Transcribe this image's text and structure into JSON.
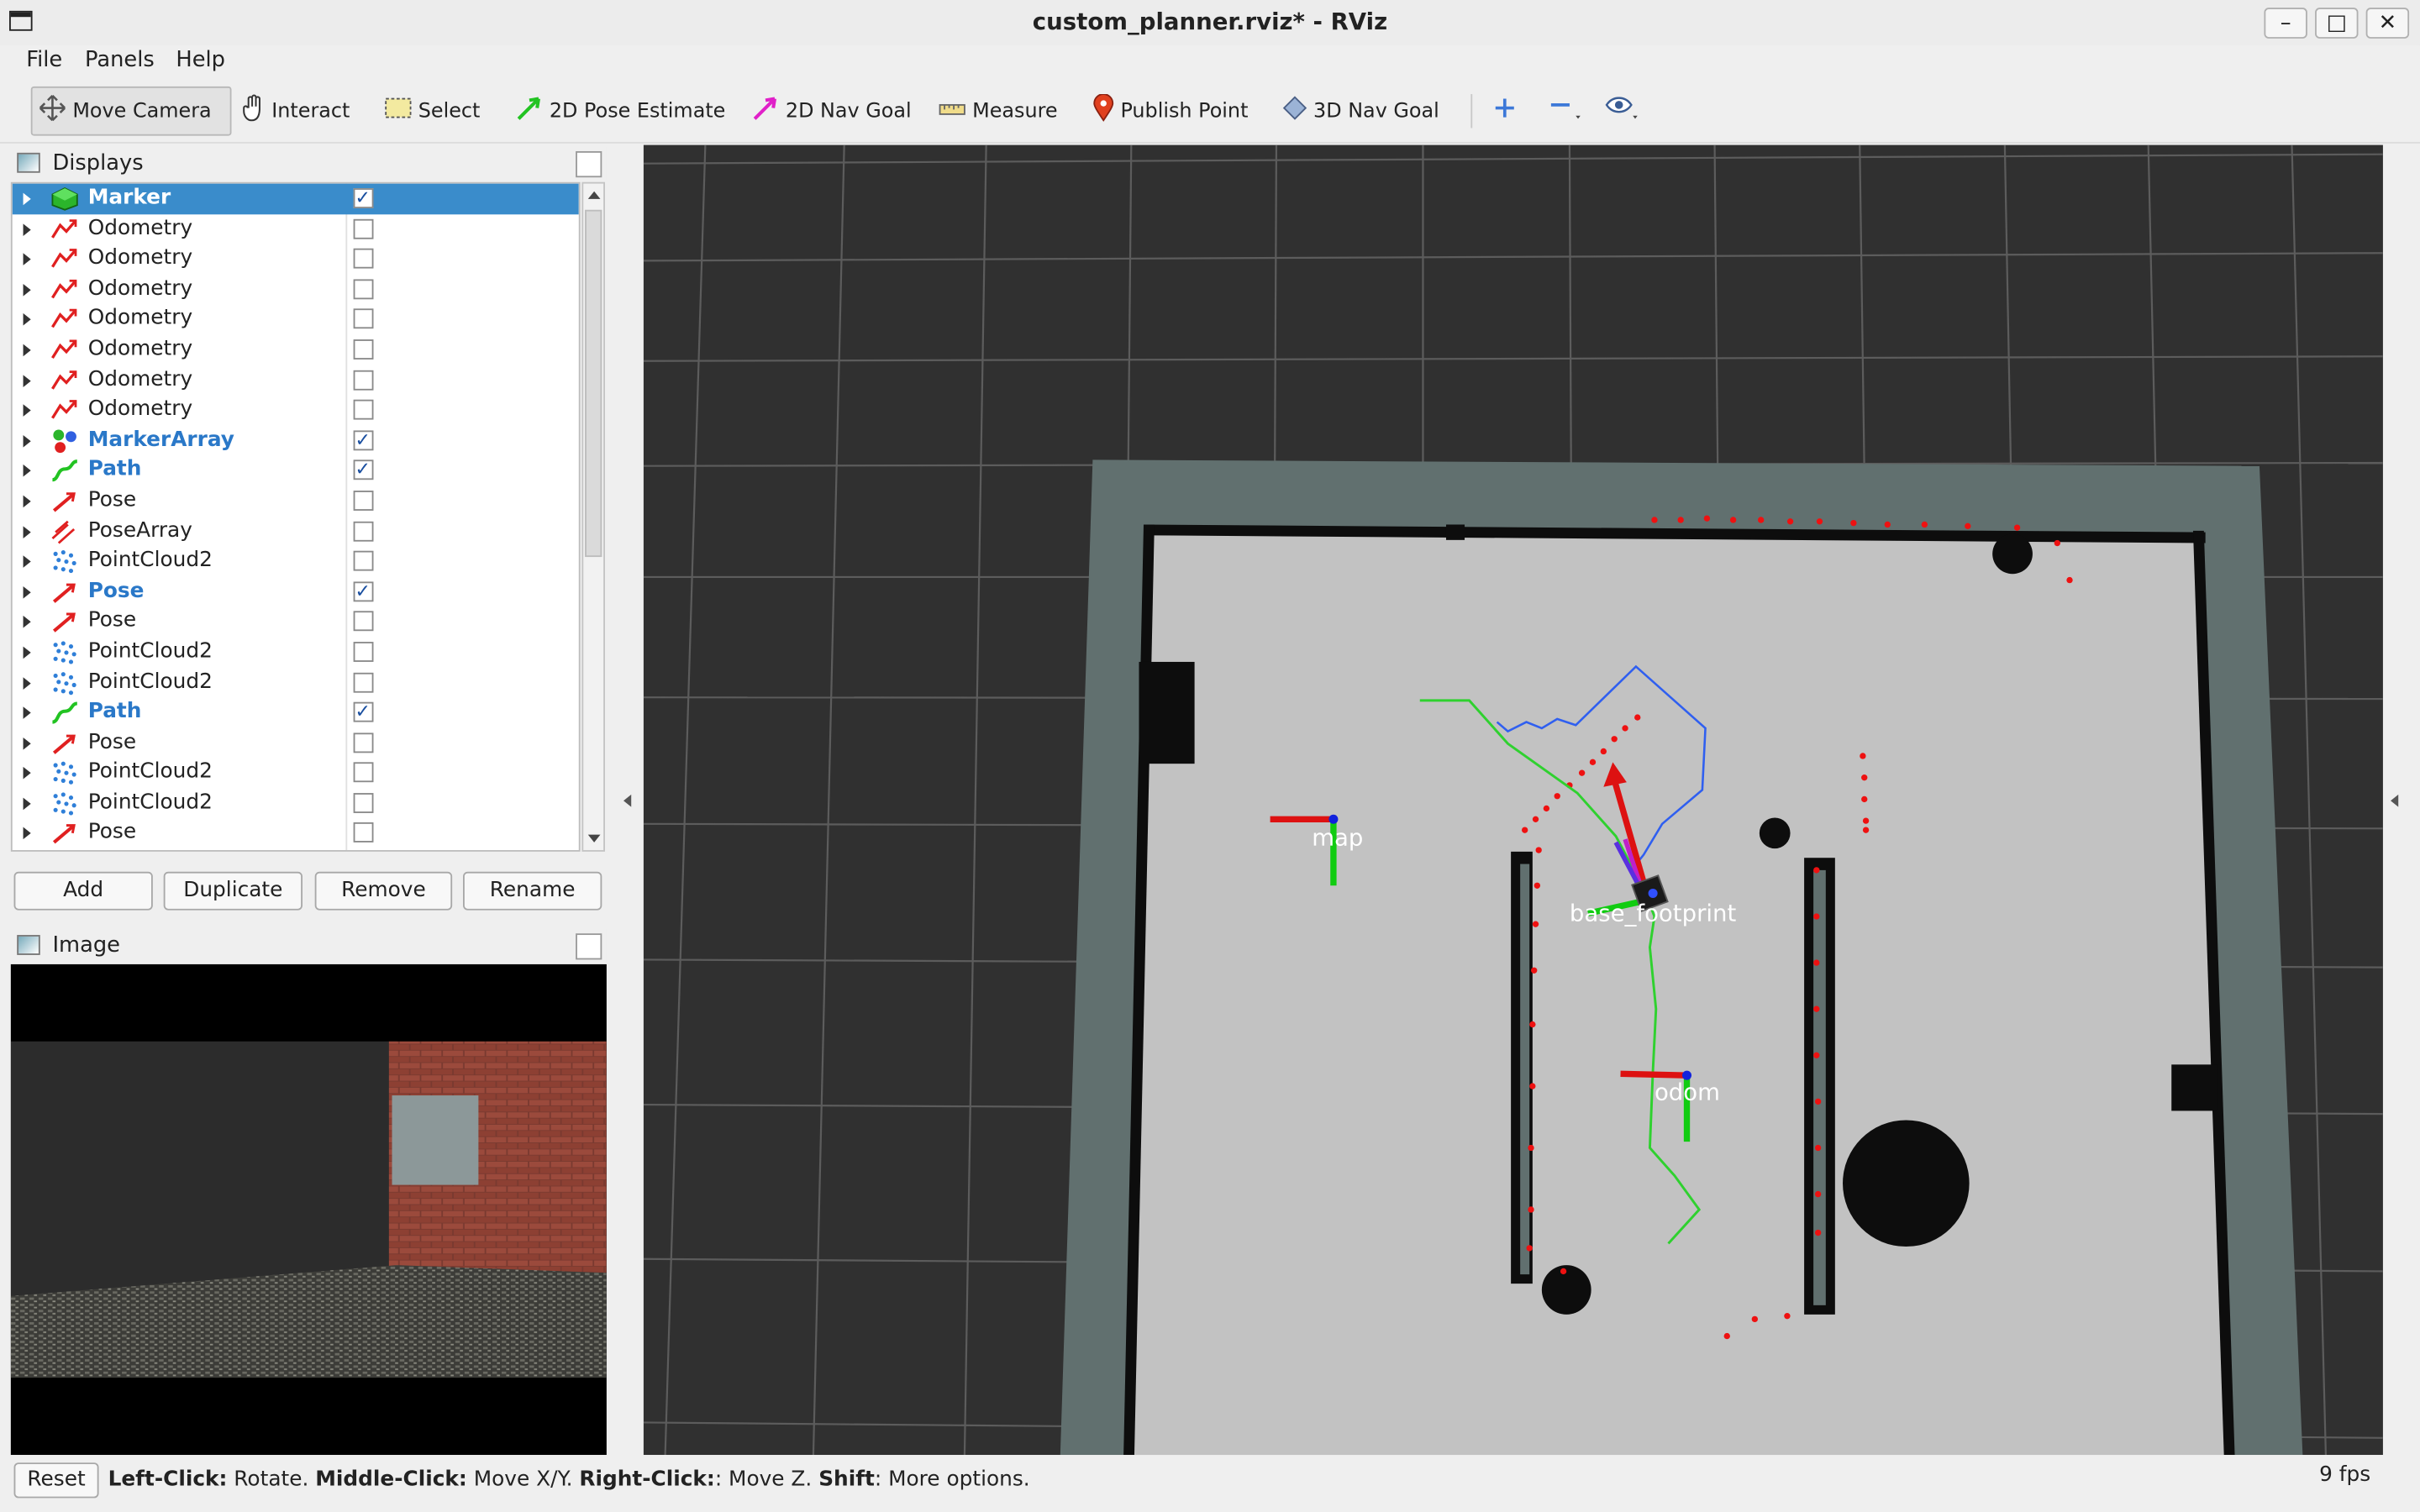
{
  "window": {
    "title": "custom_planner.rviz* - RViz"
  },
  "menu": {
    "file": "File",
    "panels": "Panels",
    "help": "Help"
  },
  "toolbar": {
    "move_camera": "Move Camera",
    "interact": "Interact",
    "select": "Select",
    "pose_estimate": "2D Pose Estimate",
    "nav_goal": "2D Nav Goal",
    "measure": "Measure",
    "publish_point": "Publish Point",
    "nav_goal_3d": "3D Nav Goal"
  },
  "displays_panel": {
    "title": "Displays",
    "items": [
      {
        "name": "Marker",
        "checked": true,
        "bold": true,
        "selected": true,
        "icon": "marker-icon"
      },
      {
        "name": "Odometry",
        "checked": false,
        "bold": false,
        "icon": "odometry-icon"
      },
      {
        "name": "Odometry",
        "checked": false,
        "bold": false,
        "icon": "odometry-icon"
      },
      {
        "name": "Odometry",
        "checked": false,
        "bold": false,
        "icon": "odometry-icon"
      },
      {
        "name": "Odometry",
        "checked": false,
        "bold": false,
        "icon": "odometry-icon"
      },
      {
        "name": "Odometry",
        "checked": false,
        "bold": false,
        "icon": "odometry-icon"
      },
      {
        "name": "Odometry",
        "checked": false,
        "bold": false,
        "icon": "odometry-icon"
      },
      {
        "name": "Odometry",
        "checked": false,
        "bold": false,
        "icon": "odometry-icon"
      },
      {
        "name": "MarkerArray",
        "checked": true,
        "bold": true,
        "icon": "markerarray-icon"
      },
      {
        "name": "Path",
        "checked": true,
        "bold": true,
        "icon": "path-icon"
      },
      {
        "name": "Pose",
        "checked": false,
        "bold": false,
        "icon": "pose-icon"
      },
      {
        "name": "PoseArray",
        "checked": false,
        "bold": false,
        "icon": "posearray-icon"
      },
      {
        "name": "PointCloud2",
        "checked": false,
        "bold": false,
        "icon": "pointcloud-icon"
      },
      {
        "name": "Pose",
        "checked": true,
        "bold": true,
        "icon": "pose-icon"
      },
      {
        "name": "Pose",
        "checked": false,
        "bold": false,
        "icon": "pose-icon"
      },
      {
        "name": "PointCloud2",
        "checked": false,
        "bold": false,
        "icon": "pointcloud-icon"
      },
      {
        "name": "PointCloud2",
        "checked": false,
        "bold": false,
        "icon": "pointcloud-icon"
      },
      {
        "name": "Path",
        "checked": true,
        "bold": true,
        "icon": "path-icon"
      },
      {
        "name": "Pose",
        "checked": false,
        "bold": false,
        "icon": "pose-icon"
      },
      {
        "name": "PointCloud2",
        "checked": false,
        "bold": false,
        "icon": "pointcloud-icon"
      },
      {
        "name": "PointCloud2",
        "checked": false,
        "bold": false,
        "icon": "pointcloud-icon"
      },
      {
        "name": "Pose",
        "checked": false,
        "bold": false,
        "icon": "pose-icon"
      }
    ],
    "buttons": {
      "add": "Add",
      "duplicate": "Duplicate",
      "remove": "Remove",
      "rename": "Rename"
    }
  },
  "image_panel": {
    "title": "Image"
  },
  "viewport": {
    "frame_labels": {
      "map": "map",
      "base": "base_footprint",
      "odom": "odom"
    },
    "colors": {
      "background": "#303030",
      "grid": "#5a5a5a",
      "free_space": "#c2c2c2",
      "unknown": "#61706f",
      "obstacle": "#0d0d0d",
      "path_green": "#2fd12f",
      "path_blue": "#2f5ff0",
      "marker_red": "#ee1111"
    }
  },
  "status": {
    "reset": "Reset",
    "hint_leftclick_key": "Left-Click:",
    "hint_leftclick_val": " Rotate. ",
    "hint_middle_key": "Middle-Click:",
    "hint_middle_val": " Move X/Y. ",
    "hint_right_key": "Right-Click:",
    "hint_right_val": ": Move Z. ",
    "hint_shift_key": "Shift",
    "hint_shift_val": ": More options.",
    "fps": "9 fps"
  }
}
